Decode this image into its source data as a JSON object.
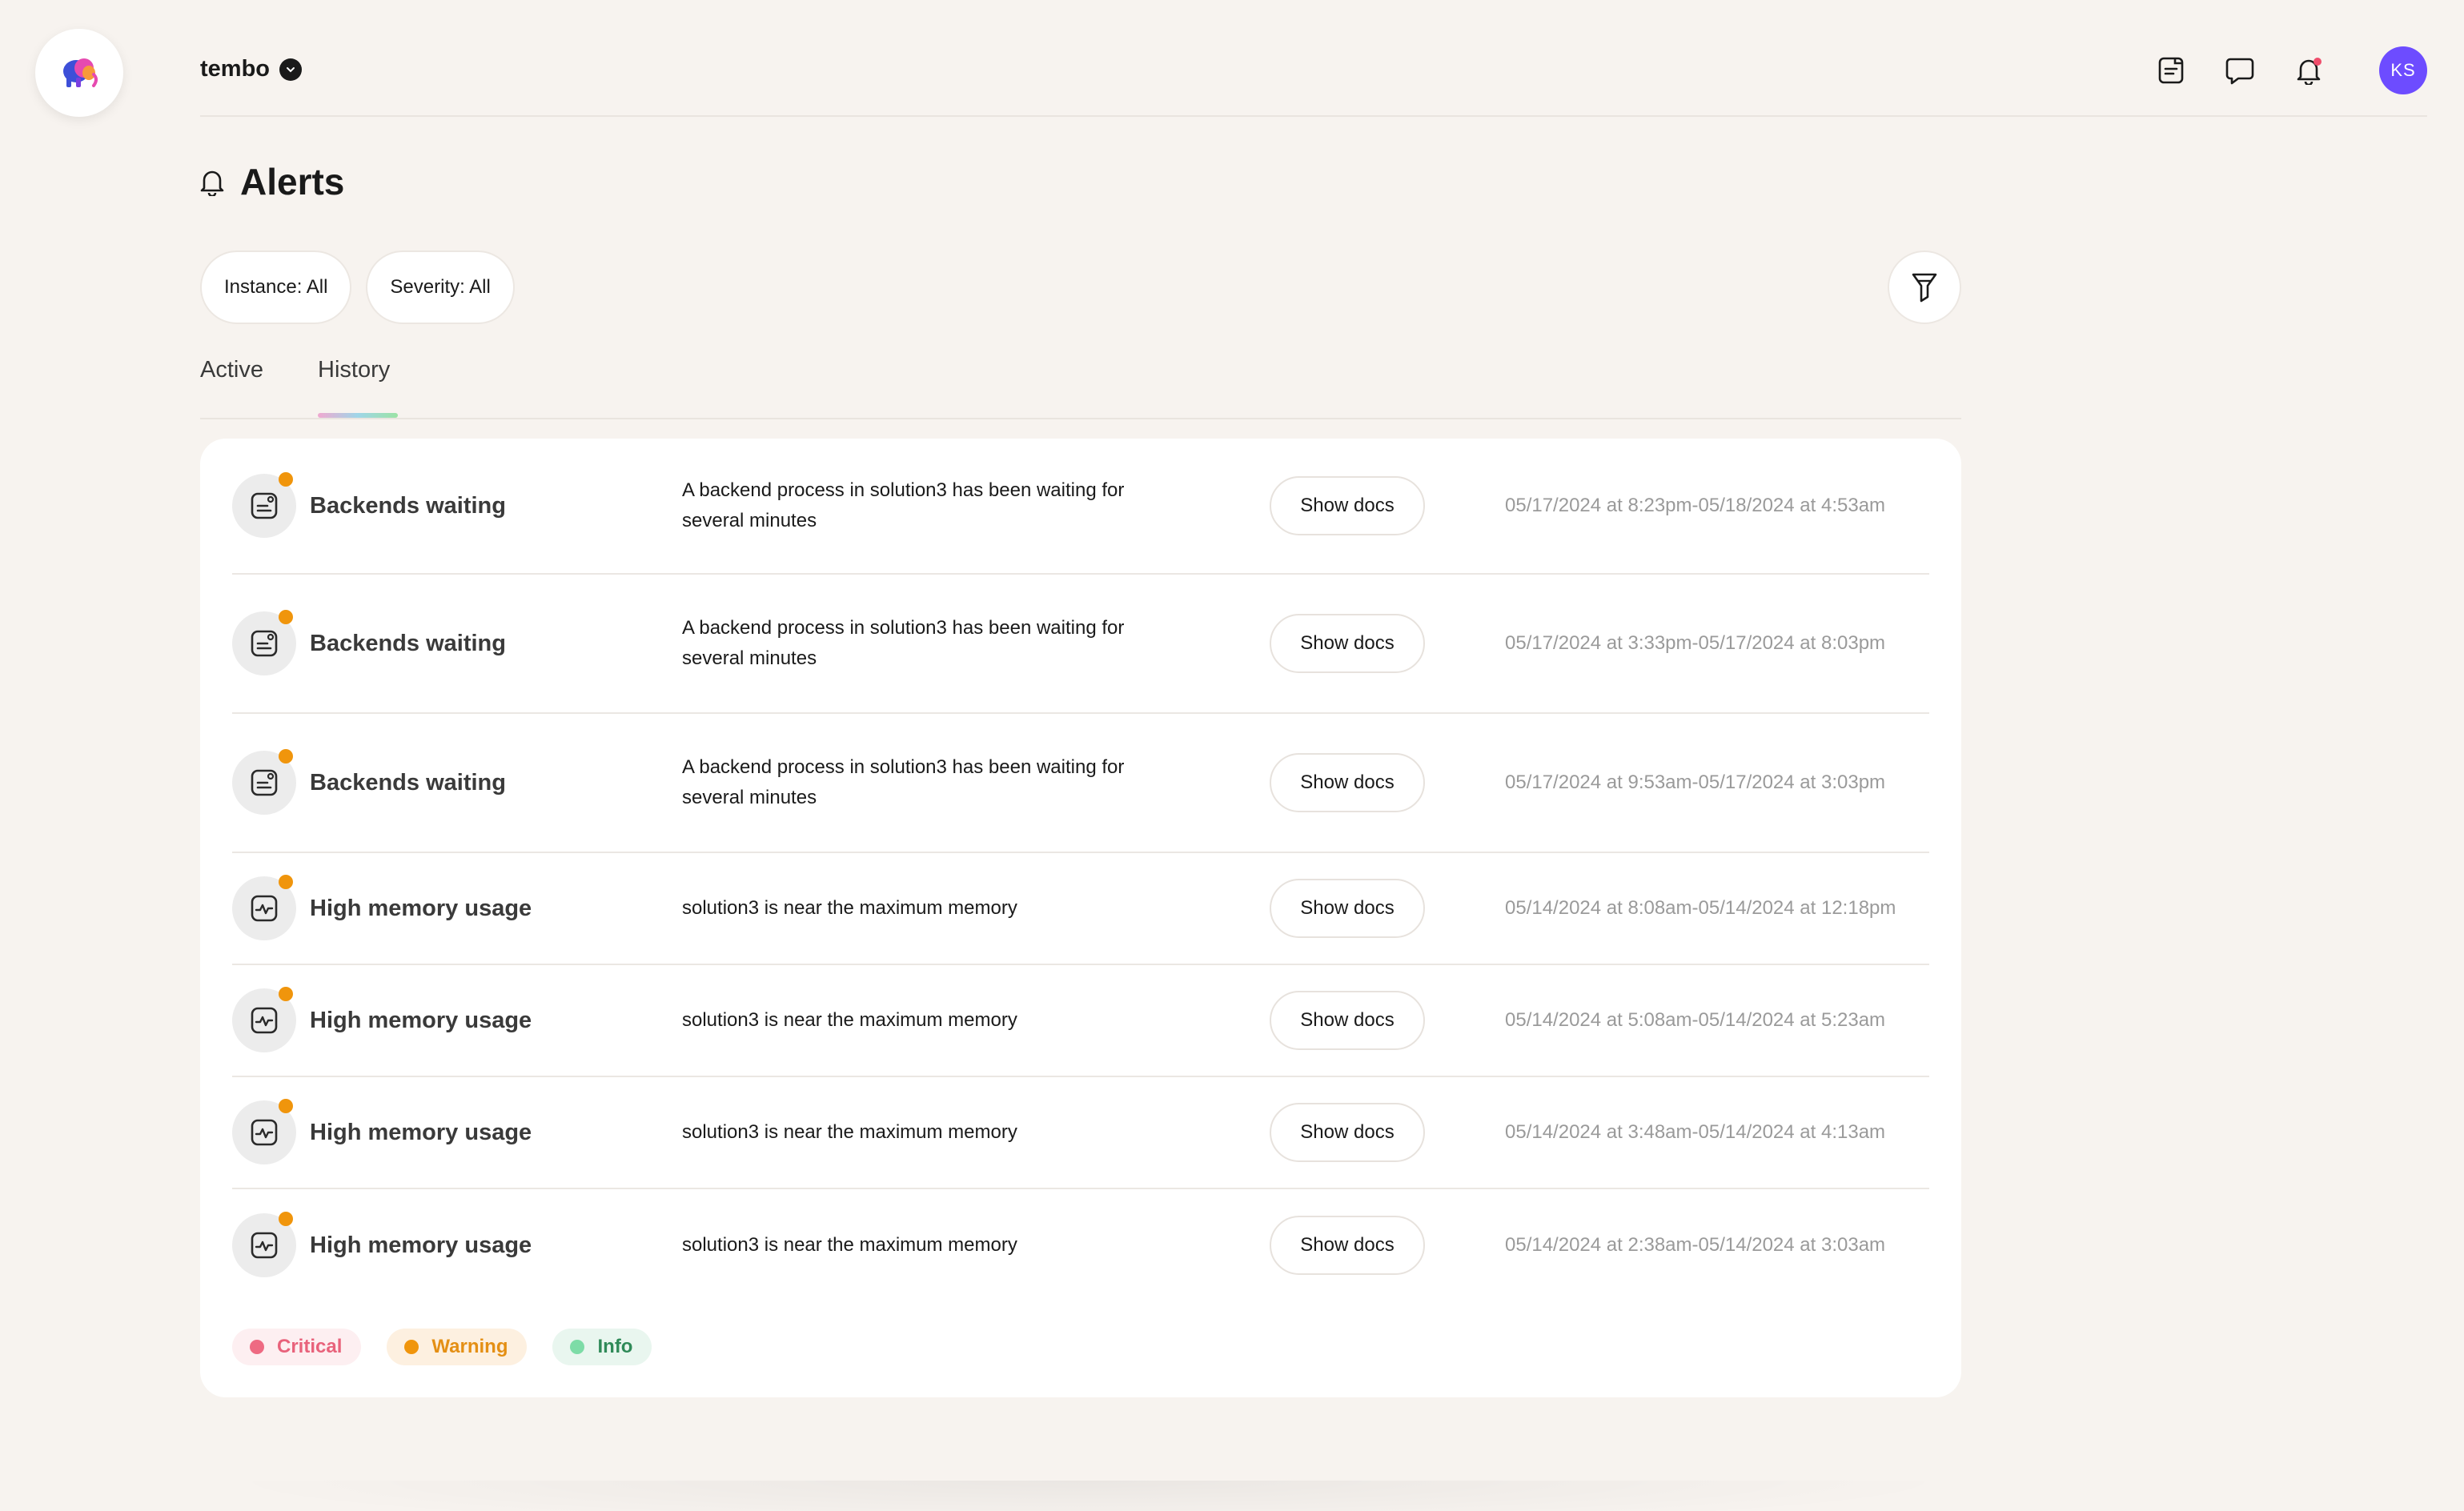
{
  "header": {
    "org_name": "tembo",
    "icons": [
      "docs-icon",
      "chat-icon",
      "bell-icon"
    ],
    "avatar_initials": "KS",
    "avatar_color": "#6d4cff"
  },
  "page": {
    "title": "Alerts",
    "title_icon": "bell-icon"
  },
  "filters": {
    "instance_label": "Instance: All",
    "severity_label": "Severity: All"
  },
  "tabs": [
    {
      "label": "Active",
      "selected": false
    },
    {
      "label": "History",
      "selected": true
    }
  ],
  "alerts": [
    {
      "title": "Backends waiting",
      "icon": "backend-icon",
      "severity": "warning",
      "description": "A backend process in solution3 has been waiting for several minutes",
      "button": "Show docs",
      "time": "05/17/2024 at 8:23pm-05/18/2024 at 4:53am"
    },
    {
      "title": "Backends waiting",
      "icon": "backend-icon",
      "severity": "warning",
      "description": "A backend process in solution3 has been waiting for several minutes",
      "button": "Show docs",
      "time": "05/17/2024 at 3:33pm-05/17/2024 at 8:03pm"
    },
    {
      "title": "Backends waiting",
      "icon": "backend-icon",
      "severity": "warning",
      "description": "A backend process in solution3 has been waiting for several minutes",
      "button": "Show docs",
      "time": "05/17/2024 at 9:53am-05/17/2024 at 3:03pm"
    },
    {
      "title": "High memory usage",
      "icon": "memory-icon",
      "severity": "warning",
      "description": "solution3 is near the maximum memory",
      "button": "Show docs",
      "time": "05/14/2024 at 8:08am-05/14/2024 at 12:18pm"
    },
    {
      "title": "High memory usage",
      "icon": "memory-icon",
      "severity": "warning",
      "description": "solution3 is near the maximum memory",
      "button": "Show docs",
      "time": "05/14/2024 at 5:08am-05/14/2024 at 5:23am"
    },
    {
      "title": "High memory usage",
      "icon": "memory-icon",
      "severity": "warning",
      "description": "solution3 is near the maximum memory",
      "button": "Show docs",
      "time": "05/14/2024 at 3:48am-05/14/2024 at 4:13am"
    },
    {
      "title": "High memory usage",
      "icon": "memory-icon",
      "severity": "warning",
      "description": "solution3 is near the maximum memory",
      "button": "Show docs",
      "time": "05/14/2024 at 2:38am-05/14/2024 at 3:03am"
    }
  ],
  "legend": {
    "critical": "Critical",
    "warning": "Warning",
    "info": "Info"
  },
  "colors": {
    "background": "#f7f3ef",
    "warning": "#f0950c",
    "critical": "#ee6a82",
    "info": "#7ddca7"
  }
}
